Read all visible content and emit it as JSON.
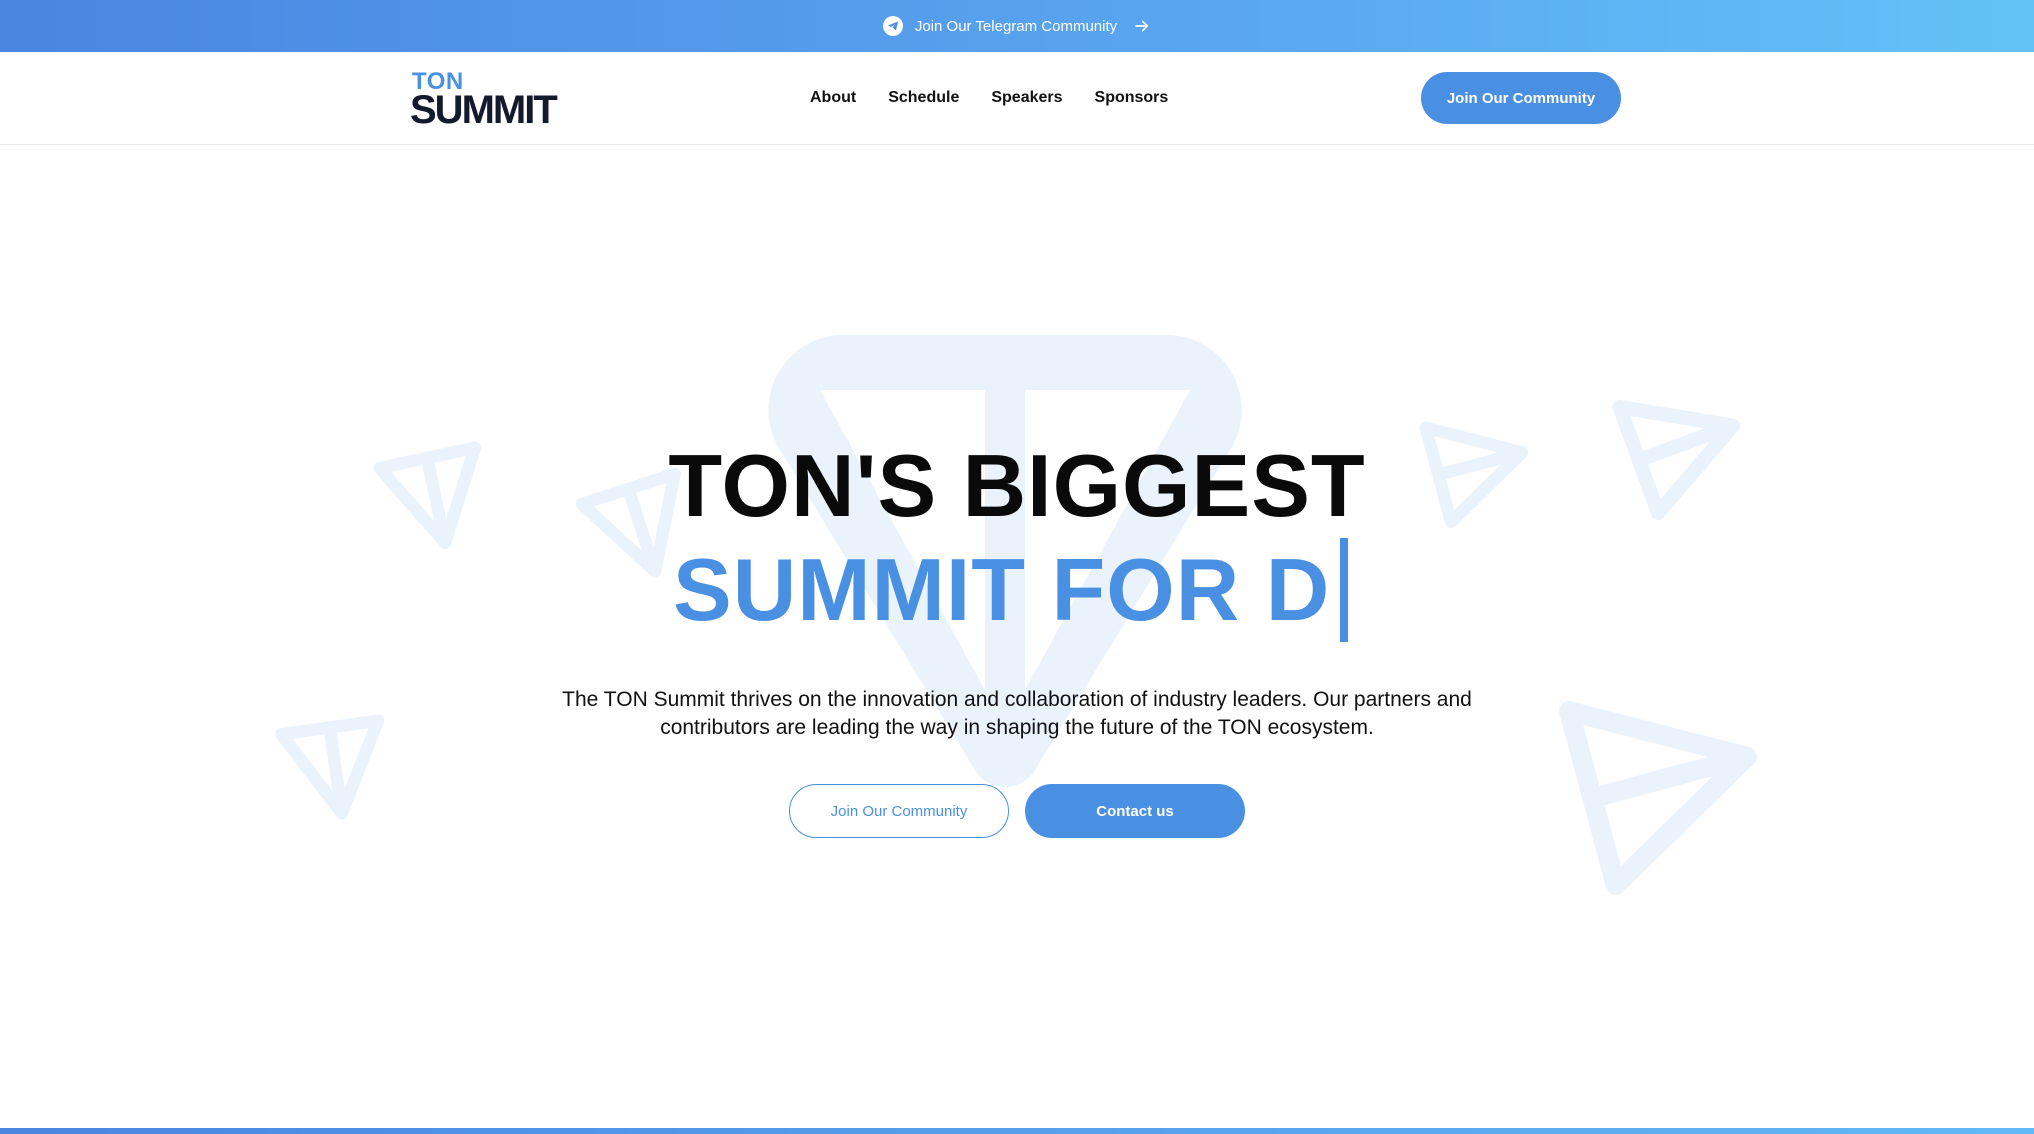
{
  "announcement": {
    "icon": "telegram-icon",
    "text": "Join Our Telegram Community",
    "arrow_icon": "arrow-right-icon"
  },
  "nav": {
    "logo_top": "TON",
    "logo_bottom": "SUMMIT",
    "menu": [
      "About",
      "Schedule",
      "Speakers",
      "Sponsors"
    ],
    "cta": "Join Our Community"
  },
  "hero": {
    "title": "TON'S BIGGEST",
    "subtitle": "SUMMIT FOR D",
    "description": "The TON Summit thrives on the innovation and collaboration of industry leaders. Our partners and contributors are leading the way in shaping the future of the TON ecosystem.",
    "primary_button": "Join Our Community",
    "secondary_button": "Contact us"
  },
  "colors": {
    "accent": "#4a90e2",
    "dark": "#141a2e",
    "decor": "#eaf3fc"
  }
}
